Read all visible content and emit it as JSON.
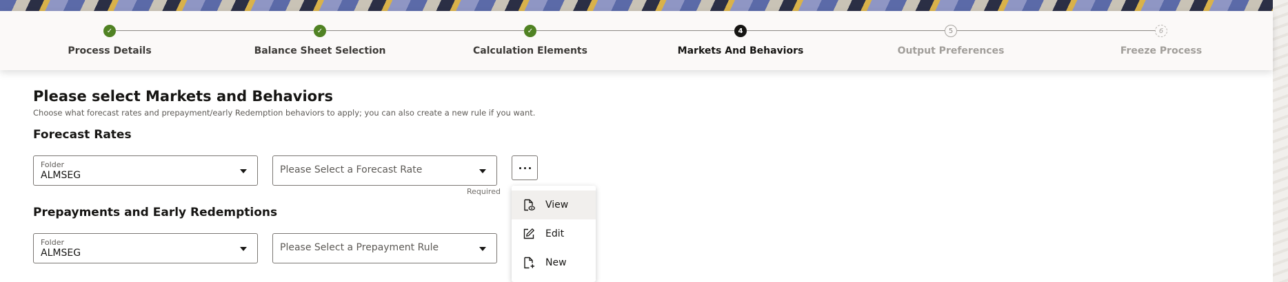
{
  "train": {
    "steps": [
      {
        "label": "Process Details",
        "status": "done",
        "marker": "✓"
      },
      {
        "label": "Balance Sheet Selection",
        "status": "done",
        "marker": "✓"
      },
      {
        "label": "Calculation Elements",
        "status": "done",
        "marker": "✓"
      },
      {
        "label": "Markets And Behaviors",
        "status": "current",
        "marker": "4"
      },
      {
        "label": "Output Preferences",
        "status": "upcoming",
        "marker": "5"
      },
      {
        "label": "Freeze Process",
        "status": "disabled",
        "marker": "6"
      }
    ]
  },
  "page": {
    "title": "Please select Markets and Behaviors",
    "description": "Choose what forecast rates and prepayment/early Redemption behaviors to apply; you can also create a new rule if you want."
  },
  "forecast": {
    "section_title": "Forecast Rates",
    "folder_label": "Folder",
    "folder_value": "ALMSEG",
    "rate_placeholder": "Please Select a Forecast Rate",
    "required_text": "Required"
  },
  "prepayment": {
    "section_title": "Prepayments and Early Redemptions",
    "folder_label": "Folder",
    "folder_value": "ALMSEG",
    "rule_placeholder": "Please Select a Prepayment Rule"
  },
  "actions_menu": {
    "button_icon": "more-horizontal-icon",
    "items": [
      {
        "label": "View",
        "icon": "view-document-icon"
      },
      {
        "label": "Edit",
        "icon": "edit-icon"
      },
      {
        "label": "New",
        "icon": "new-document-icon"
      }
    ]
  },
  "colors": {
    "done": "#508223",
    "current": "#161513",
    "upcoming": "#a8a5a1"
  }
}
